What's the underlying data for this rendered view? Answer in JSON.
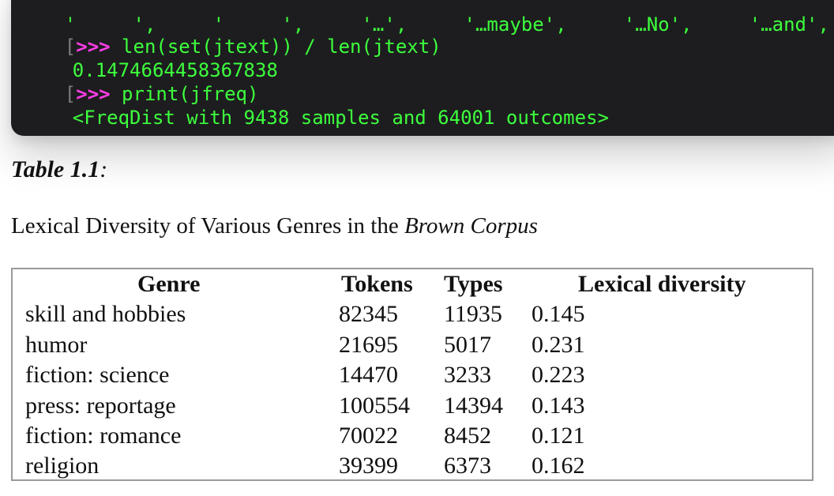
{
  "terminal": {
    "partial_top_line": "'     ',     '     ',     '…',     '…maybe',     '…No',     '…and',     '→' ]",
    "lines": [
      {
        "bracket": "[",
        "prompt": ">>>",
        "command": " len(set(jtext)) / len(jtext)"
      },
      {
        "output": "0.1474664458367838"
      },
      {
        "bracket": "[",
        "prompt": ">>>",
        "command": " print(jfreq)"
      },
      {
        "output": "<FreqDist with 9438 samples and 64001 outcomes>"
      },
      {
        "prompt": ">>>"
      }
    ]
  },
  "caption": {
    "number": "Table 1.1",
    "separator": ":"
  },
  "title": {
    "prefix": "Lexical Diversity of Various Genres in the ",
    "emphasis": "Brown Corpus"
  },
  "table": {
    "headers": [
      "Genre",
      "Tokens",
      "Types",
      "Lexical diversity"
    ],
    "rows": [
      [
        "skill and hobbies",
        "82345",
        "11935",
        "0.145"
      ],
      [
        "humor",
        "21695",
        "5017",
        "0.231"
      ],
      [
        "fiction: science",
        "14470",
        "3233",
        "0.223"
      ],
      [
        "press: reportage",
        "100554",
        "14394",
        "0.143"
      ],
      [
        "fiction: romance",
        "70022",
        "8452",
        "0.121"
      ],
      [
        "religion",
        "39399",
        "6373",
        "0.162"
      ]
    ]
  }
}
